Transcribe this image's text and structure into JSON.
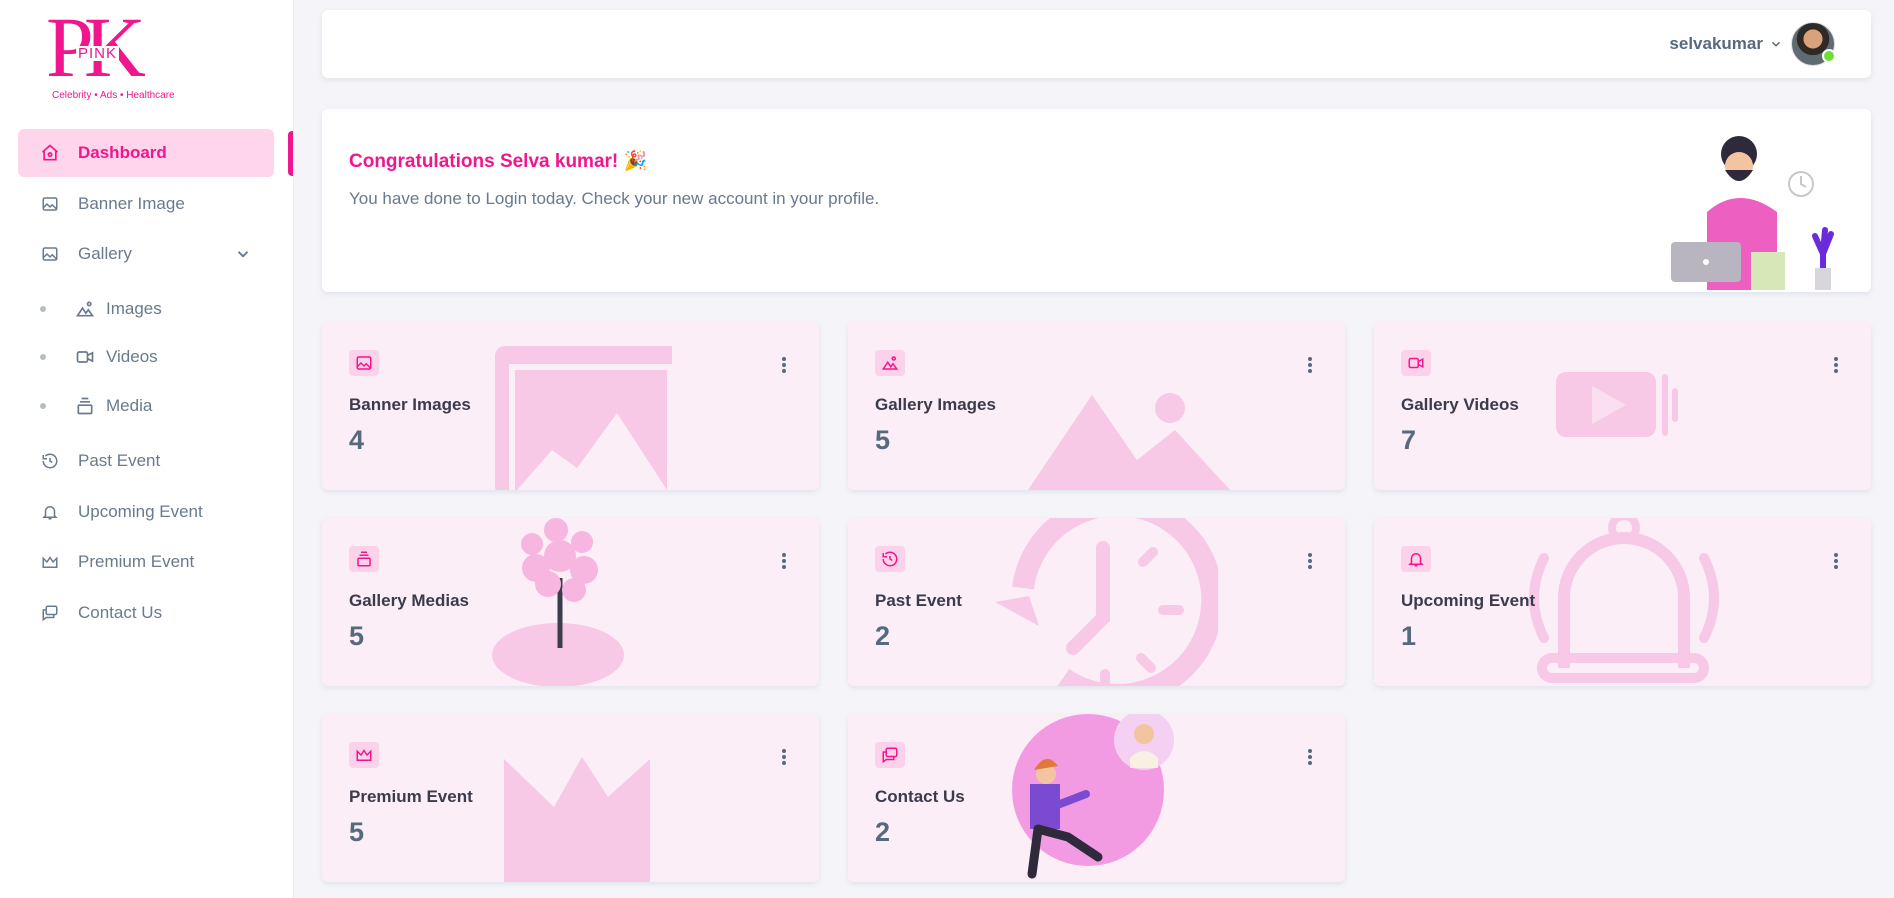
{
  "brand": {
    "logo_letters": "PK",
    "logo_word": "PINK",
    "tagline": "Celebrity • Ads • Healthcare",
    "accent": "#f0168d"
  },
  "sidebar": {
    "items": [
      {
        "label": "Dashboard",
        "icon": "home-icon",
        "active": true
      },
      {
        "label": "Banner Image",
        "icon": "image-icon"
      },
      {
        "label": "Gallery",
        "icon": "image-icon",
        "expanded": true
      },
      {
        "label": "Past Event",
        "icon": "history-icon"
      },
      {
        "label": "Upcoming Event",
        "icon": "bell-icon"
      },
      {
        "label": "Premium Event",
        "icon": "crown-icon"
      },
      {
        "label": "Contact Us",
        "icon": "messages-icon"
      }
    ],
    "gallery_sub": [
      {
        "label": "Images",
        "icon": "mountain-icon"
      },
      {
        "label": "Videos",
        "icon": "video-icon"
      },
      {
        "label": "Media",
        "icon": "stack-icon"
      }
    ]
  },
  "navbar": {
    "username": "selvakumar"
  },
  "welcome": {
    "title": "Congratulations Selva kumar! 🎉",
    "message": "You have done to Login today. Check your new account in your profile."
  },
  "cards": [
    {
      "title": "Banner Images",
      "value": "4",
      "icon": "image-icon"
    },
    {
      "title": "Gallery Images",
      "value": "5",
      "icon": "mountain-icon"
    },
    {
      "title": "Gallery Videos",
      "value": "7",
      "icon": "video-icon"
    },
    {
      "title": "Gallery Medias",
      "value": "5",
      "icon": "stack-icon"
    },
    {
      "title": "Past Event",
      "value": "2",
      "icon": "history-icon"
    },
    {
      "title": "Upcoming Event",
      "value": "1",
      "icon": "bell-icon"
    },
    {
      "title": "Premium Event",
      "value": "5",
      "icon": "crown-icon"
    },
    {
      "title": "Contact Us",
      "value": "2",
      "icon": "messages-icon"
    }
  ]
}
